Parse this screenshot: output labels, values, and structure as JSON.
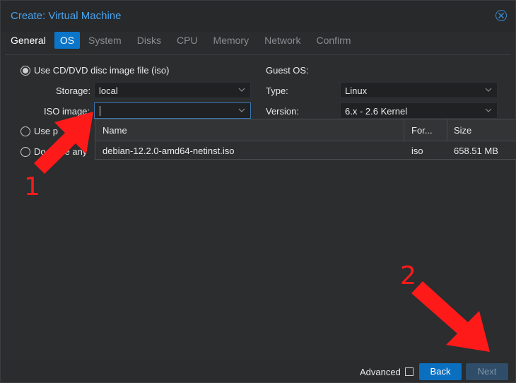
{
  "window": {
    "title": "Create: Virtual Machine"
  },
  "tabs": [
    {
      "label": "General"
    },
    {
      "label": "OS",
      "active": true
    },
    {
      "label": "System"
    },
    {
      "label": "Disks"
    },
    {
      "label": "CPU"
    },
    {
      "label": "Memory"
    },
    {
      "label": "Network"
    },
    {
      "label": "Confirm"
    }
  ],
  "media": {
    "option_iso": "Use CD/DVD disc image file (iso)",
    "storage_label": "Storage:",
    "storage_value": "local",
    "iso_label": "ISO image:",
    "iso_value": "",
    "option_physical": "Use p",
    "option_none": "Do",
    "option_none_tail": "se any"
  },
  "guest_os": {
    "heading": "Guest OS:",
    "type_label": "Type:",
    "type_value": "Linux",
    "version_label": "Version:",
    "version_value": "6.x - 2.6 Kernel"
  },
  "iso_popup": {
    "columns": [
      "Name",
      "For...",
      "Size"
    ],
    "rows": [
      {
        "name": "debian-12.2.0-amd64-netinst.iso",
        "format": "iso",
        "size": "658.51 MB"
      }
    ]
  },
  "footer": {
    "advanced_label": "Advanced",
    "back_label": "Back",
    "next_label": "Next"
  },
  "annotations": {
    "one": "1",
    "two": "2",
    "color": "#ff1a1a"
  },
  "colors": {
    "accent": "#0b75c9",
    "title": "#4aa3ec"
  }
}
